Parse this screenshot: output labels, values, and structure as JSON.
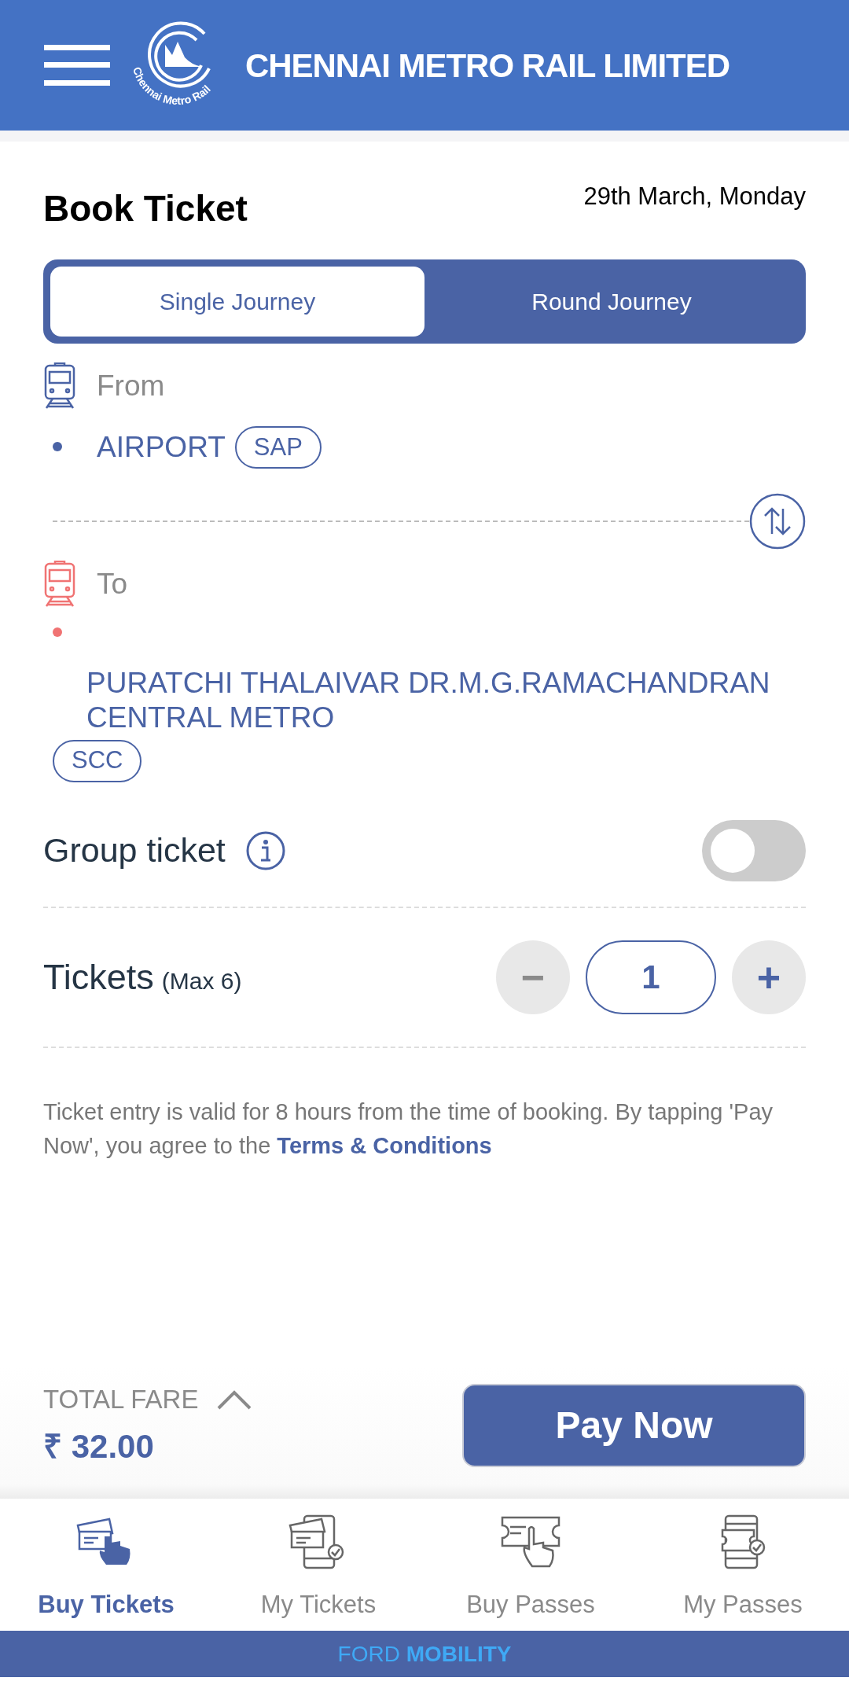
{
  "header": {
    "title": "CHENNAI METRO RAIL LIMITED",
    "logo_caption": "Chennai Metro Rail"
  },
  "page": {
    "title": "Book Ticket",
    "date": "29th March, Monday"
  },
  "journey_tabs": [
    {
      "label": "Single Journey",
      "selected": true
    },
    {
      "label": "Round Journey",
      "selected": false
    }
  ],
  "stops": [
    {
      "kind": "from",
      "label": "From",
      "station": "AIRPORT",
      "code": "SAP"
    },
    {
      "kind": "to",
      "label": "To",
      "station": "PURATCHI THALAIVAR DR.M.G.RAMACHANDRAN CENTRAL METRO",
      "code": "SCC"
    }
  ],
  "group_ticket": {
    "label": "Group ticket",
    "on": false
  },
  "tickets": {
    "label": "Tickets",
    "limit": "(Max 6)",
    "minus": "−",
    "count": "1",
    "plus": "+"
  },
  "notice": {
    "text": "Ticket entry is valid for 8 hours from the time of booking. By tapping 'Pay Now', you agree to the",
    "link": "Terms & Conditions"
  },
  "fare": {
    "label": "TOTAL FARE",
    "amount": "₹ 32.00",
    "pay_button": "Pay Now"
  },
  "bottom_nav": [
    {
      "kind": "buy-tickets",
      "label": "Buy Tickets",
      "selected": true
    },
    {
      "kind": "my-tickets",
      "label": "My Tickets",
      "selected": false
    },
    {
      "kind": "buy-passes",
      "label": "Buy Passes",
      "selected": false
    },
    {
      "kind": "my-passes",
      "label": "My Passes",
      "selected": false
    }
  ],
  "footer": "FORD **MOBILITY**"
}
